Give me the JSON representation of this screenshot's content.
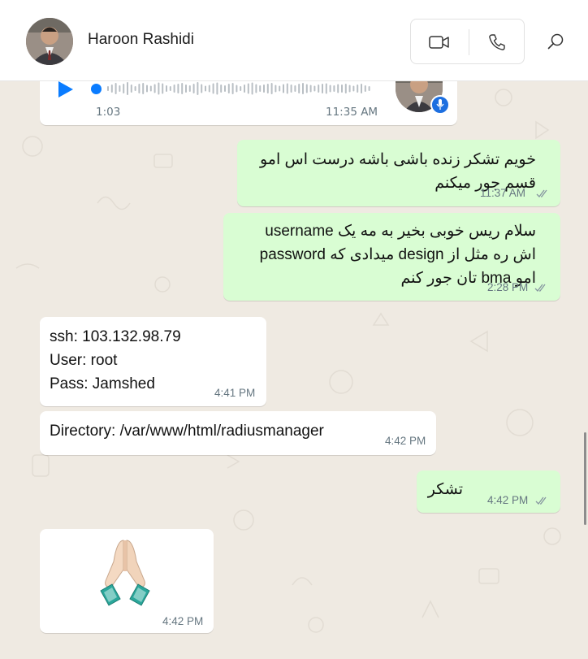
{
  "contact": {
    "name": "Haroon Rashidi"
  },
  "header_icons": {
    "video": "video-camera-icon",
    "voice": "phone-icon",
    "search": "search-icon"
  },
  "voice_message": {
    "duration": "1:03",
    "time": "11:35 AM",
    "progress": 0.0
  },
  "messages": [
    {
      "dir": "out",
      "lines": [
        "خویم تشکر زنده باشی باشه درست اس امو",
        "قسم جور میکنم"
      ],
      "time": "11:37 AM",
      "status": "read"
    },
    {
      "dir": "out",
      "lines": [
        "سلام ریس خوبی بخیر به مه یک  username",
        "password میدادی که design  اش ره مثل از",
        "امو bma تان جور کنم"
      ],
      "time": "2:28 PM",
      "status": "read"
    },
    {
      "dir": "in",
      "lines": [
        "ssh: 103.132.98.79",
        "User: root",
        "Pass: Jamshed"
      ],
      "time": "4:41 PM"
    },
    {
      "dir": "in",
      "lines": [
        "Directory: /var/www/html/radiusmanager"
      ],
      "time": "4:42 PM"
    },
    {
      "dir": "out",
      "lines": [
        "تشکر"
      ],
      "time": "4:42 PM",
      "status": "read"
    },
    {
      "dir": "in",
      "emoji": "folded-hands",
      "time": "4:42 PM"
    }
  ],
  "colors": {
    "incoming": "#ffffff",
    "outgoing": "#d9fdd3",
    "accent": "#0a7cff",
    "background": "#efeae2"
  }
}
